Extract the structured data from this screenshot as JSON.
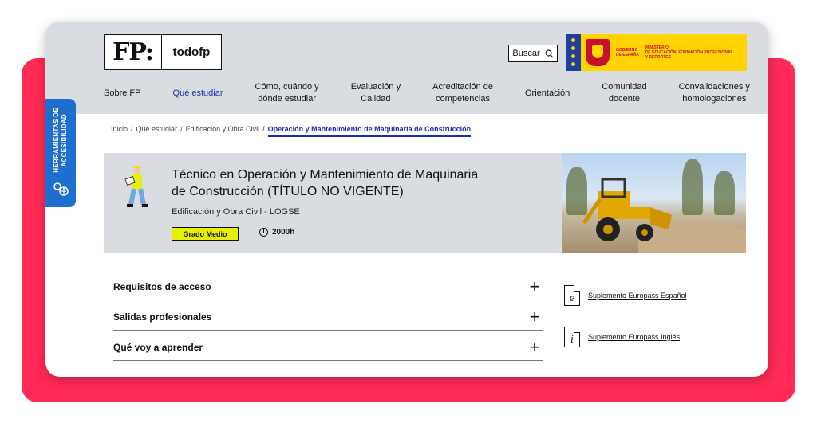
{
  "logo": {
    "mark": "FP:",
    "name": "todofp"
  },
  "search": {
    "label": "Buscar"
  },
  "government": {
    "line1": "GOBIERNO",
    "line2": "DE ESPAÑA",
    "ministry1": "MINISTERIO",
    "ministry2": "DE EDUCACIÓN, FORMACIÓN PROFESIONAL",
    "ministry3": "Y DEPORTES"
  },
  "nav": {
    "items": [
      {
        "line1": "Sobre FP",
        "line2": ""
      },
      {
        "line1": "Qué estudiar",
        "line2": ""
      },
      {
        "line1": "Cómo, cuándo y",
        "line2": "dónde estudiar"
      },
      {
        "line1": "Evaluación y",
        "line2": "Calidad"
      },
      {
        "line1": "Acreditación de",
        "line2": "competencias"
      },
      {
        "line1": "Orientación",
        "line2": ""
      },
      {
        "line1": "Comunidad",
        "line2": "docente"
      },
      {
        "line1": "Convalidaciones y",
        "line2": "homologaciones"
      }
    ]
  },
  "breadcrumb": {
    "items": [
      "Inicio",
      "/",
      "Qué estudiar",
      "/",
      "Edificación y Obra Civil",
      "/"
    ],
    "current": "Operación y Mantenimiento de Maquinaria de Construcción"
  },
  "hero": {
    "title_line1": "Técnico en Operación y Mantenimiento de Maquinaria",
    "title_line2": "de Construcción (TÍTULO NO VIGENTE)",
    "subtitle": "Edificación y Obra Civil - LOGSE",
    "level": "Grado Medio",
    "hours": "2000h"
  },
  "accordion": {
    "items": [
      {
        "label": "Requisitos de acceso",
        "icon": "+"
      },
      {
        "label": "Salidas profesionales",
        "icon": "+"
      },
      {
        "label": "Qué voy a aprender",
        "icon": "+"
      }
    ]
  },
  "documents": {
    "items": [
      {
        "glyph": "e",
        "label": "Suplemento Europass Español"
      },
      {
        "glyph": "i",
        "label": "Suplemento Europass Inglés"
      }
    ]
  },
  "accessibility": {
    "line1": "HERRAMIENTAS DE",
    "line2": "ACCESIBILIDAD"
  },
  "colors": {
    "accent": "#1a2fb0",
    "background": "#ff2a55",
    "header": "#d9dde1",
    "badge": "#e6f000",
    "a11y": "#1e6ecf"
  }
}
